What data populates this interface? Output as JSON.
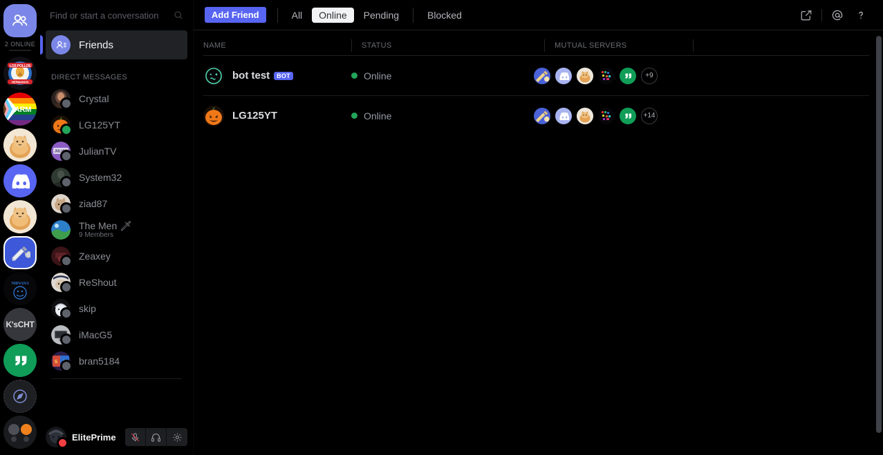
{
  "app": {
    "name": "Discord",
    "online_count_label": "2 ONLINE"
  },
  "server_rail": {
    "home_button": {
      "name": "home-friends-button",
      "icon": "discord-friends-icon"
    },
    "servers": [
      {
        "name": "Los Pollos Hermanos",
        "icon": "server-icon-los-pollos",
        "selected": false,
        "shape": "circle"
      },
      {
        "name": "ARM Pride",
        "icon": "server-icon-arm-rainbow",
        "selected": false,
        "shape": "circle"
      },
      {
        "name": "Cat Bread",
        "icon": "server-icon-cat-bread",
        "selected": false,
        "shape": "circle"
      },
      {
        "name": "Discord",
        "icon": "server-icon-discord-blurple",
        "selected": false,
        "shape": "circle"
      },
      {
        "name": "Cat Bread 2",
        "icon": "server-icon-cat-bread-2",
        "selected": false,
        "shape": "circle"
      },
      {
        "name": "Tools",
        "icon": "server-icon-tools-wrench",
        "selected": true,
        "shape": "square"
      },
      {
        "name": "Nirvana Smiley",
        "icon": "server-icon-nirvana-smiley",
        "selected": false,
        "shape": "circle"
      },
      {
        "name": "K'sCHT",
        "icon": "server-icon-kscht",
        "label": "K'sCHT",
        "selected": false,
        "shape": "circle"
      },
      {
        "name": "Hangouts",
        "icon": "server-icon-green-quotes",
        "selected": false,
        "shape": "circle"
      },
      {
        "name": "Explore Public Servers",
        "icon": "compass-icon",
        "selected": false,
        "shape": "circle"
      },
      {
        "name": "Loading",
        "icon": "server-icon-dots",
        "selected": false,
        "shape": "circle"
      }
    ]
  },
  "sidebar": {
    "search": {
      "placeholder": "Find or start a conversation",
      "icon": "search-icon"
    },
    "friends_item": {
      "label": "Friends",
      "icon": "friends-icon",
      "selected": true
    },
    "dm_header": "DIRECT MESSAGES",
    "dms": [
      {
        "name": "Crystal",
        "status": "offline",
        "avatar": "avatar-crystal"
      },
      {
        "name": "LG125YT",
        "status": "online",
        "avatar": "avatar-pumpkin"
      },
      {
        "name": "JulianTV",
        "status": "offline",
        "avatar": "avatar-julian"
      },
      {
        "name": "System32",
        "status": "offline",
        "avatar": "avatar-system32"
      },
      {
        "name": "ziad87",
        "status": "offline",
        "avatar": "avatar-ziad87"
      },
      {
        "name": "The Men 🗡",
        "subtitle": "9 Members",
        "status": "none",
        "avatar": "avatar-the-men"
      },
      {
        "name": "Zeaxey",
        "status": "offline",
        "avatar": "avatar-zeaxey"
      },
      {
        "name": "ReShout",
        "status": "offline",
        "avatar": "avatar-reshout"
      },
      {
        "name": "skip",
        "status": "offline",
        "avatar": "avatar-skip"
      },
      {
        "name": "iMacG5",
        "status": "offline",
        "avatar": "avatar-imacg5"
      },
      {
        "name": "bran5184",
        "status": "offline",
        "avatar": "avatar-bran5184"
      }
    ]
  },
  "user_panel": {
    "username": "ElitePrime",
    "status": "dnd",
    "buttons": [
      {
        "name": "mute-microphone-button",
        "icon": "microphone-muted-icon",
        "active": true
      },
      {
        "name": "deafen-button",
        "icon": "headphones-icon",
        "active": false
      },
      {
        "name": "user-settings-button",
        "icon": "gear-icon",
        "active": false
      }
    ]
  },
  "topbar": {
    "add_friend_label": "Add Friend",
    "tabs": [
      {
        "label": "All",
        "active": false
      },
      {
        "label": "Online",
        "active": true
      },
      {
        "label": "Pending",
        "active": false
      },
      {
        "label": "Blocked",
        "active": false
      }
    ],
    "actions": [
      {
        "name": "new-dm-button",
        "icon": "new-dm-icon"
      },
      {
        "name": "inbox-mentions-button",
        "icon": "at-icon"
      },
      {
        "name": "help-button",
        "icon": "question-mark-icon"
      }
    ]
  },
  "friends_table": {
    "columns": [
      "NAME",
      "STATUS",
      "MUTUAL SERVERS"
    ],
    "rows": [
      {
        "name": "bot test",
        "is_bot": true,
        "bot_badge": "BOT",
        "avatar": "avatar-woozy-face",
        "status": "Online",
        "status_color": "#23a55a",
        "mutual_servers": [
          "server-icon-tools-wrench",
          "server-icon-discord-blurple",
          "server-icon-cat-bread",
          "server-icon-pixel-dark",
          "server-icon-green-quotes"
        ],
        "mutual_overflow": "+9"
      },
      {
        "name": "LG125YT",
        "is_bot": false,
        "avatar": "avatar-pumpkin",
        "status": "Online",
        "status_color": "#23a55a",
        "mutual_servers": [
          "server-icon-tools-wrench",
          "server-icon-discord-blurple",
          "server-icon-cat-bread",
          "server-icon-pixel-dark",
          "server-icon-green-quotes"
        ],
        "mutual_overflow": "+14"
      }
    ]
  },
  "colors": {
    "brand": "#5865f2",
    "online": "#23a55a",
    "dnd": "#f23f43",
    "offline": "#5e626b",
    "background": "#000000",
    "active_tab_bg": "#f2f3f5"
  }
}
